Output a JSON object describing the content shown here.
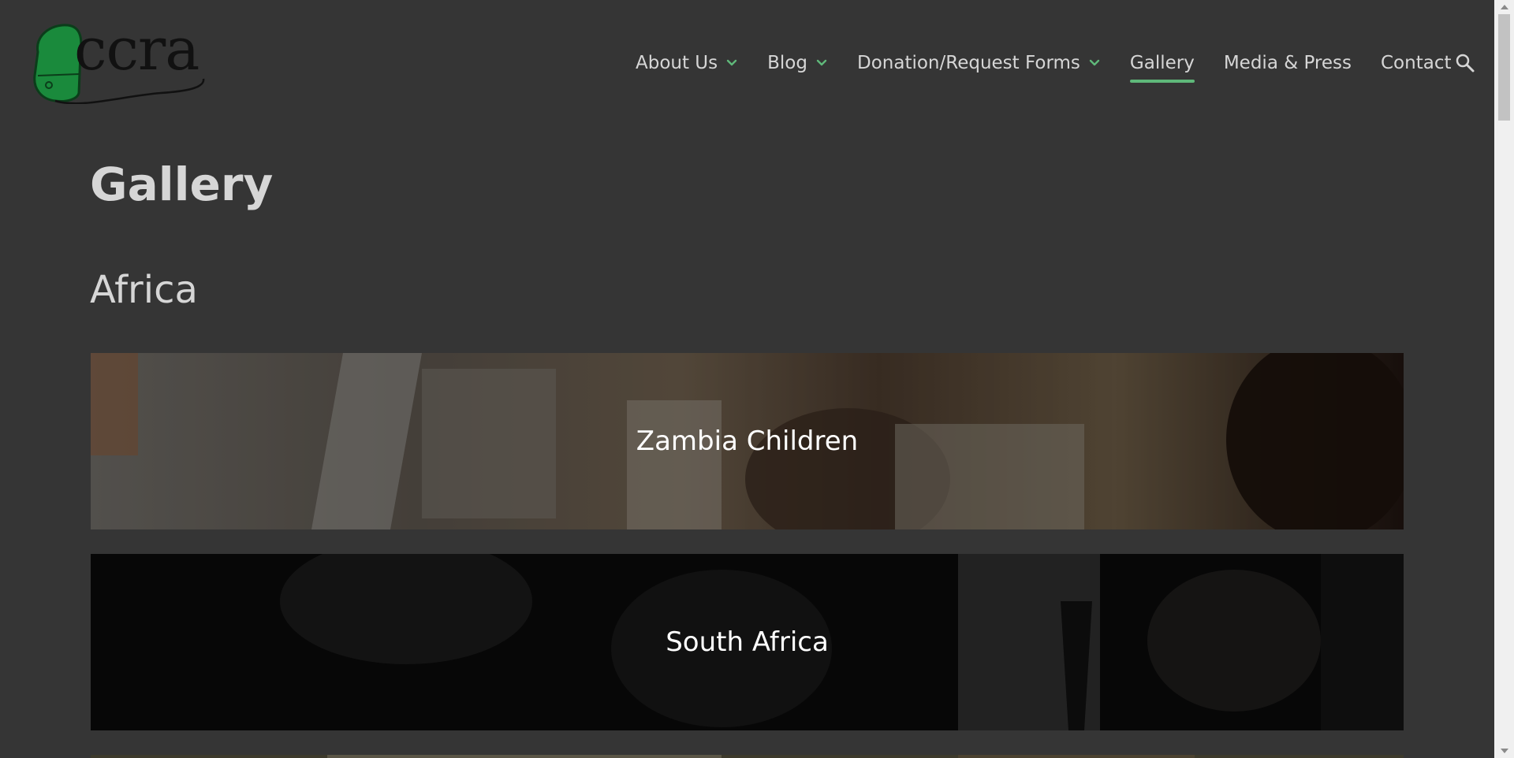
{
  "header": {
    "logo_text": "ccra",
    "nav": [
      {
        "label": "About Us",
        "has_dropdown": true,
        "active": false
      },
      {
        "label": "Blog",
        "has_dropdown": true,
        "active": false
      },
      {
        "label": "Donation/Request Forms",
        "has_dropdown": true,
        "active": false
      },
      {
        "label": "Gallery",
        "has_dropdown": false,
        "active": true
      },
      {
        "label": "Media & Press",
        "has_dropdown": false,
        "active": false
      },
      {
        "label": "Contact",
        "has_dropdown": false,
        "active": false
      }
    ],
    "search_icon": "search-icon"
  },
  "main": {
    "page_title": "Gallery",
    "section_title": "Africa",
    "albums": [
      {
        "label": "Zambia Children"
      },
      {
        "label": "South Africa"
      },
      {
        "label": ""
      }
    ]
  },
  "colors": {
    "background": "#353535",
    "accent": "#5fb87a",
    "text": "#d6d6d6",
    "logo_green": "#1a8a3c"
  }
}
